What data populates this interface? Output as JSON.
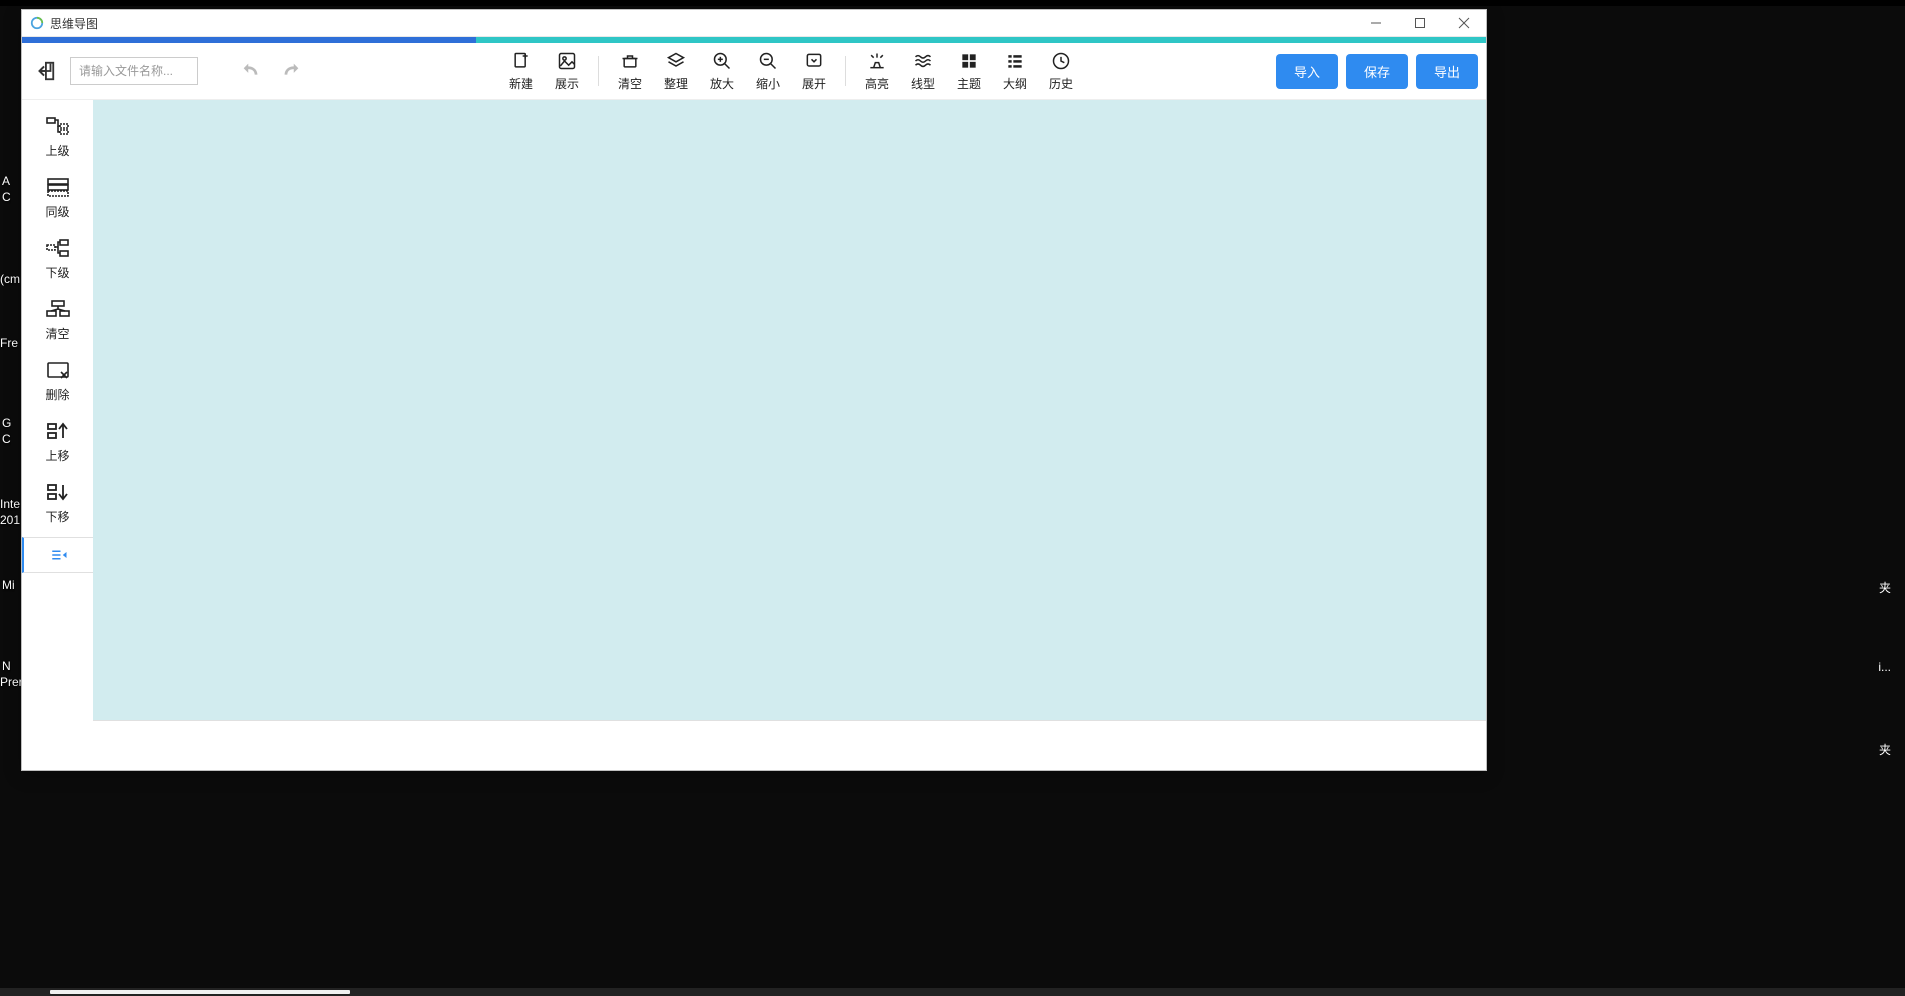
{
  "window": {
    "title": "思维导图"
  },
  "toolbar": {
    "placeholder": "请输入文件名称...",
    "items": [
      {
        "label": "新建"
      },
      {
        "label": "展示"
      },
      {
        "label": "清空"
      },
      {
        "label": "整理"
      },
      {
        "label": "放大"
      },
      {
        "label": "缩小"
      },
      {
        "label": "展开"
      },
      {
        "label": "高亮"
      },
      {
        "label": "线型"
      },
      {
        "label": "主题"
      },
      {
        "label": "大纲"
      },
      {
        "label": "历史"
      }
    ],
    "actions": {
      "import": "导入",
      "save": "保存",
      "export": "导出"
    }
  },
  "sidebar": {
    "items": [
      {
        "label": "上级"
      },
      {
        "label": "同级"
      },
      {
        "label": "下级"
      },
      {
        "label": "清空"
      },
      {
        "label": "删除"
      },
      {
        "label": "上移"
      },
      {
        "label": "下移"
      }
    ]
  },
  "desktop": {
    "left_labels": [
      "A",
      "C",
      "(cm",
      "Fre",
      "G",
      "C",
      "Inte",
      "201",
      "Mi",
      "N",
      "Prer"
    ],
    "right_labels": [
      "夹",
      "i...",
      "夹"
    ]
  }
}
